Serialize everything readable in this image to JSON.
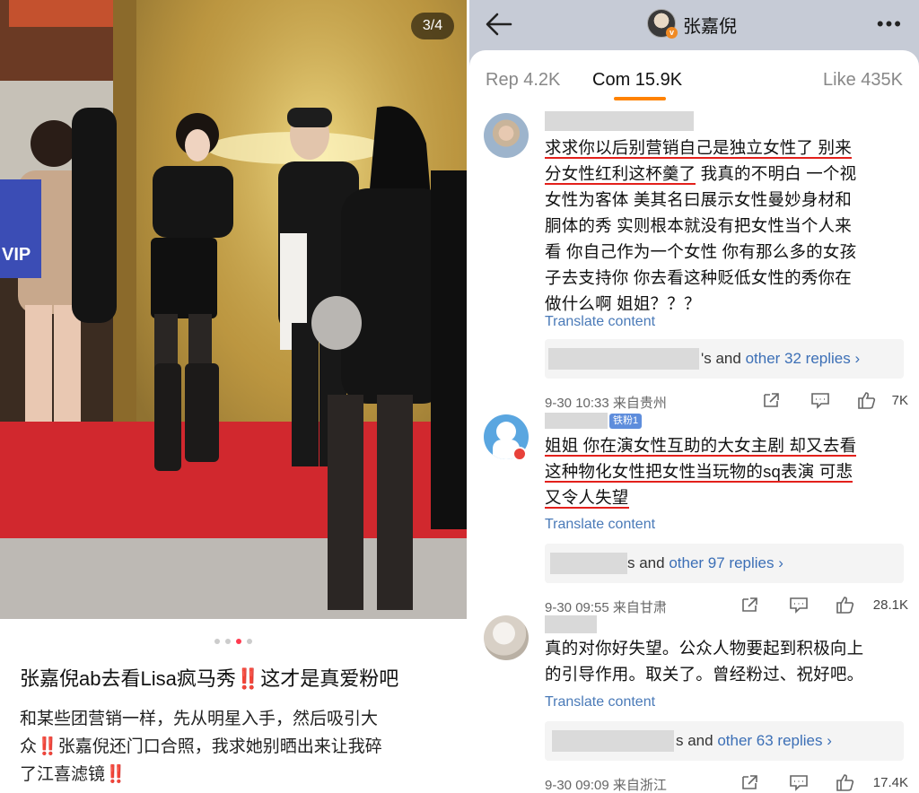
{
  "post": {
    "image_counter": "3/4",
    "title_parts": [
      "张嘉倪ab去看Lisa疯马秀",
      "‼️",
      "这才是真爱粉吧"
    ],
    "body_line1": "和某些团营销一样，先从明星入手，然后吸引大",
    "body_line2_pre": "众",
    "body_line2_bang": "‼️",
    "body_line2_post": "张嘉倪还门口合照，我求她别晒出来让我碎",
    "body_line3_pre": "了江喜滤镜",
    "body_line3_bang": "‼️",
    "sign_text": "VIP"
  },
  "header": {
    "user_name": "张嘉倪",
    "more_label": "•••"
  },
  "tabs": [
    {
      "label": "Rep 4.2K"
    },
    {
      "label": "Com 15.9K"
    },
    {
      "label": "Like 435K"
    }
  ],
  "comments": [
    {
      "lines": [
        {
          "text": "求求你以后别营销自己是独立女性了 别来",
          "underline": true
        },
        {
          "text_ul": "分女性红利这杯羹了",
          "text_rest": " 我真的不明白 一个视"
        },
        {
          "text": "女性为客体 美其名曰展示女性曼妙身材和"
        },
        {
          "text": "胴体的秀 实则根本就没有把女性当个人来"
        },
        {
          "text": "看 你自己作为一个女性 你有那么多的女孩"
        },
        {
          "text": "子去支持你 你去看这种贬低女性的秀你在"
        },
        {
          "text": "做什么啊 姐姐？？？"
        }
      ],
      "translate": "Translate content",
      "reply_suffix": "'s and ",
      "reply_link": "other 32 replies",
      "date": "9-30 10:33 来自贵州",
      "likes": "7K"
    },
    {
      "badge": "铁粉1",
      "lines": [
        {
          "text": "姐姐 你在演女性互助的大女主剧 却又去看",
          "underline": true
        },
        {
          "text": "这种物化女性把女性当玩物的sq表演 可悲",
          "underline": true
        },
        {
          "text": "又令人失望",
          "underline": true
        }
      ],
      "translate": "Translate content",
      "reply_suffix": "s and ",
      "reply_link": "other 97 replies",
      "date": "9-30 09:55 来自甘肃",
      "likes": "28.1K"
    },
    {
      "lines": [
        {
          "text": "真的对你好失望。公众人物要起到积极向上"
        },
        {
          "text": "的引导作用。取关了。曾经粉过、祝好吧。"
        }
      ],
      "translate": "Translate content",
      "reply_suffix": "s and ",
      "reply_link": "other 63 replies",
      "date": "9-30 09:09 来自浙江",
      "likes": "17.4K"
    }
  ],
  "colors": {
    "accent": "#ff8200",
    "link": "#3c6fb6",
    "underline_red": "#e3201b",
    "active_dot": "#ff3b50"
  }
}
